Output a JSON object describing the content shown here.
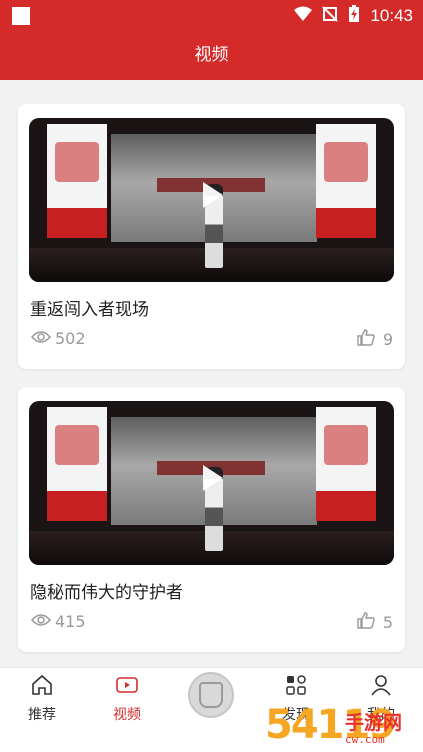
{
  "status_bar": {
    "time": "10:43"
  },
  "header": {
    "title": "视频"
  },
  "videos": [
    {
      "title": "重返闯入者现场",
      "views": "502",
      "likes": "9"
    },
    {
      "title": "隐秘而伟大的守护者",
      "views": "415",
      "likes": "5"
    }
  ],
  "tabs": {
    "home": "推荐",
    "video": "视频",
    "discover": "发现",
    "mine": "我的"
  },
  "watermark": {
    "logo": "54119",
    "site": "手游网",
    "domain": "cw.com"
  },
  "colors": {
    "brand": "#d42a2a",
    "tab_active": "#d42a2a"
  }
}
